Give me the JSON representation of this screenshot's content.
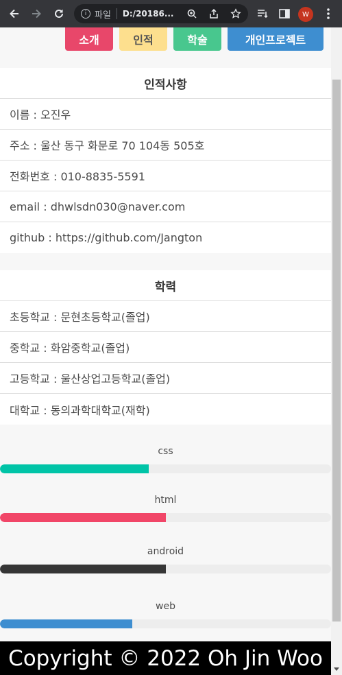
{
  "browser": {
    "scheme_label": "파일",
    "url": "D:/20186...",
    "avatar_letter": "W"
  },
  "nav": {
    "items": [
      {
        "label": "소개",
        "color": "#e8476a"
      },
      {
        "label": "인적",
        "color": "#fddf8e"
      },
      {
        "label": "학술",
        "color": "#48c78e"
      },
      {
        "label": "개인프로젝트",
        "color": "#3e8ed0"
      }
    ]
  },
  "profile": {
    "title": "인적사항",
    "rows": [
      "이름 : 오진우",
      "주소 : 울산 동구 화문로 70 104동 505호",
      "전화번호 : 010-8835-5591",
      "email : dhwlsdn030@naver.com",
      "github : https://github.com/Jangton"
    ]
  },
  "education": {
    "title": "학력",
    "rows": [
      "초등학교 : 문현초등학교(졸업)",
      "중학교 : 화암중학교(졸업)",
      "고등학교 : 울산상업고등학교(졸업)",
      "대학교 : 동의과학대학교(재학)"
    ]
  },
  "skills": [
    {
      "name": "css",
      "level": 0.45,
      "color": "#00c4a7"
    },
    {
      "name": "html",
      "level": 0.5,
      "color": "#f14668"
    },
    {
      "name": "android",
      "level": 0.5,
      "color": "#363636"
    },
    {
      "name": "web",
      "level": 0.4,
      "color": "#3e8ed0"
    }
  ],
  "footer": {
    "text": "Copyright © 2022 Oh Jin Woo"
  }
}
